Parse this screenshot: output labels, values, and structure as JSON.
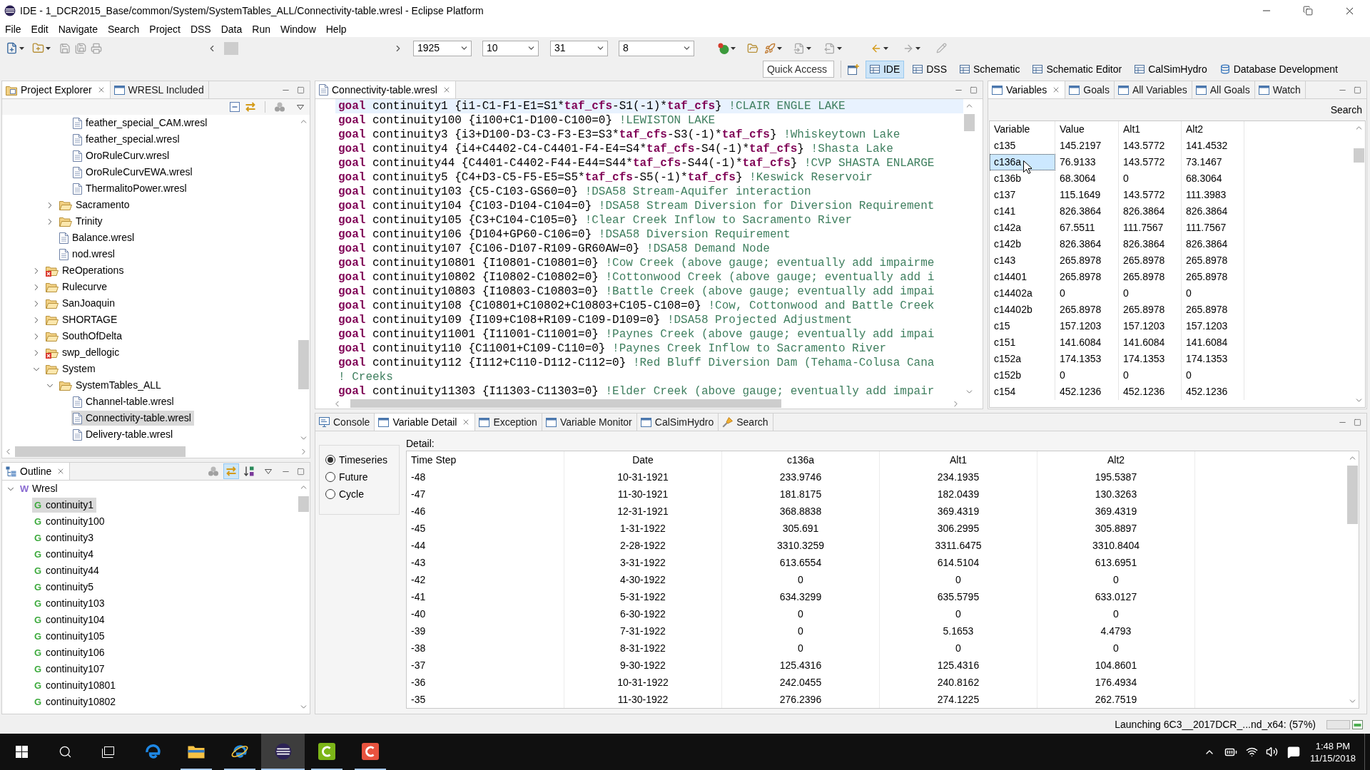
{
  "window": {
    "title": "IDE - 1_DCR2015_Base/common/System/SystemTables_ALL/Connectivity-table.wresl - Eclipse Platform"
  },
  "menu_bar": [
    "File",
    "Edit",
    "Navigate",
    "Search",
    "Project",
    "DSS",
    "Data",
    "Run",
    "Window",
    "Help"
  ],
  "toolbar": {
    "dropdowns": [
      "1925",
      "10",
      "31",
      "8"
    ]
  },
  "quick_access": {
    "placeholder": "Quick Access"
  },
  "perspectives": [
    {
      "label": "IDE",
      "selected": true,
      "kind": "view"
    },
    {
      "label": "DSS",
      "selected": false,
      "kind": "view"
    },
    {
      "label": "Schematic",
      "selected": false,
      "kind": "view"
    },
    {
      "label": "Schematic Editor",
      "selected": false,
      "kind": "view"
    },
    {
      "label": "CalSimHydro",
      "selected": false,
      "kind": "view"
    },
    {
      "label": "Database Development",
      "selected": false,
      "kind": "database"
    }
  ],
  "project_explorer": {
    "tabs": [
      {
        "label": "Project Explorer",
        "selected": true,
        "kind": "explorer"
      },
      {
        "label": "WRESL Included",
        "selected": false,
        "kind": "view"
      }
    ],
    "toolbar": [
      {
        "kind": "collapse",
        "on": false
      },
      {
        "kind": "link",
        "on": false
      },
      {
        "kind": "filter",
        "on": false
      }
    ],
    "tree": [
      {
        "children": [
          {
            "children": [
              {
                "label": "feather_special_CAM.wresl",
                "kind": "file",
                "selected": false,
                "error": false
              },
              {
                "label": "feather_special.wresl",
                "kind": "file",
                "selected": false,
                "error": false
              },
              {
                "label": "OroRuleCurv.wresl",
                "kind": "file",
                "selected": false,
                "error": false
              },
              {
                "label": "OroRuleCurvEWA.wresl",
                "kind": "file",
                "selected": false,
                "error": false
              },
              {
                "label": "ThermalitoPower.wresl",
                "kind": "file",
                "selected": false,
                "error": false
              }
            ]
          },
          {
            "label": "Sacramento",
            "kind": "folder",
            "expanded": false,
            "selected": false,
            "error": false
          },
          {
            "label": "Trinity",
            "kind": "folder",
            "expanded": false,
            "selected": false,
            "error": false
          },
          {
            "label": "Balance.wresl",
            "kind": "file",
            "selected": false,
            "error": false
          },
          {
            "label": "nod.wresl",
            "kind": "file",
            "selected": false,
            "error": false
          }
        ]
      },
      {
        "label": "ReOperations",
        "kind": "folder",
        "expanded": false,
        "selected": false,
        "error": true
      },
      {
        "label": "Rulecurve",
        "kind": "folder",
        "expanded": false,
        "selected": false,
        "error": false
      },
      {
        "label": "SanJoaquin",
        "kind": "folder",
        "expanded": false,
        "selected": false,
        "error": false
      },
      {
        "label": "SHORTAGE",
        "kind": "folder",
        "expanded": false,
        "selected": false,
        "error": false
      },
      {
        "label": "SouthOfDelta",
        "kind": "folder",
        "expanded": false,
        "selected": false,
        "error": false
      },
      {
        "label": "swp_dellogic",
        "kind": "folder",
        "expanded": false,
        "selected": false,
        "error": true
      },
      {
        "label": "System",
        "kind": "folder",
        "expanded": true,
        "selected": false,
        "error": false,
        "children": [
          {
            "label": "SystemTables_ALL",
            "kind": "folder",
            "expanded": true,
            "selected": false,
            "error": false,
            "children": [
              {
                "label": "Channel-table.wresl",
                "kind": "file",
                "selected": false,
                "error": false
              },
              {
                "label": "Connectivity-table.wresl",
                "kind": "file",
                "selected": true,
                "error": false
              },
              {
                "label": "Delivery-table.wresl",
                "kind": "file",
                "selected": false,
                "error": false
              }
            ]
          }
        ]
      }
    ]
  },
  "outline": {
    "tabs": [
      {
        "label": "Outline",
        "selected": true,
        "kind": "outline"
      }
    ],
    "toolbar": [
      {
        "kind": "filter",
        "on": false
      },
      {
        "kind": "link",
        "on": true
      },
      {
        "kind": "sort",
        "on": false
      }
    ],
    "tree": [
      {
        "label": "Wresl",
        "kind": "root",
        "letter": "W",
        "expanded": true,
        "selected": false,
        "children": [
          {
            "label": "continuity1",
            "kind": "goal",
            "letter": "G",
            "selected": true
          },
          {
            "label": "continuity100",
            "kind": "goal",
            "letter": "G",
            "selected": false
          },
          {
            "label": "continuity3",
            "kind": "goal",
            "letter": "G",
            "selected": false
          },
          {
            "label": "continuity4",
            "kind": "goal",
            "letter": "G",
            "selected": false
          },
          {
            "label": "continuity44",
            "kind": "goal",
            "letter": "G",
            "selected": false
          },
          {
            "label": "continuity5",
            "kind": "goal",
            "letter": "G",
            "selected": false
          },
          {
            "label": "continuity103",
            "kind": "goal",
            "letter": "G",
            "selected": false
          },
          {
            "label": "continuity104",
            "kind": "goal",
            "letter": "G",
            "selected": false
          },
          {
            "label": "continuity105",
            "kind": "goal",
            "letter": "G",
            "selected": false
          },
          {
            "label": "continuity106",
            "kind": "goal",
            "letter": "G",
            "selected": false
          },
          {
            "label": "continuity107",
            "kind": "goal",
            "letter": "G",
            "selected": false
          },
          {
            "label": "continuity10801",
            "kind": "goal",
            "letter": "G",
            "selected": false
          },
          {
            "label": "continuity10802",
            "kind": "goal",
            "letter": "G",
            "selected": false
          }
        ]
      }
    ]
  },
  "editor": {
    "tabs": [
      {
        "label": "Connectivity-table.wresl",
        "selected": true,
        "kind": "file"
      }
    ],
    "lines": [
      {
        "current": true,
        "segments": [
          {
            "kind": "keyword",
            "text": "goal"
          },
          {
            "kind": "code",
            "text": " continuity1 {i1-C1-F1-E1=S1*"
          },
          {
            "kind": "bold",
            "text": "taf_cfs"
          },
          {
            "kind": "code",
            "text": "-S1(-1)*"
          },
          {
            "kind": "bold",
            "text": "taf_cfs"
          },
          {
            "kind": "code",
            "text": "} "
          },
          {
            "kind": "comment",
            "text": "!CLAIR ENGLE LAKE"
          }
        ]
      },
      {
        "current": false,
        "segments": [
          {
            "kind": "keyword",
            "text": "goal"
          },
          {
            "kind": "code",
            "text": " continuity100 {i100+C1-D100-C100=0} "
          },
          {
            "kind": "comment",
            "text": "!LEWISTON LAKE"
          }
        ]
      },
      {
        "current": false,
        "segments": [
          {
            "kind": "keyword",
            "text": "goal"
          },
          {
            "kind": "code",
            "text": " continuity3 {i3+D100-D3-C3-F3-E3=S3*"
          },
          {
            "kind": "bold",
            "text": "taf_cfs"
          },
          {
            "kind": "code",
            "text": "-S3(-1)*"
          },
          {
            "kind": "bold",
            "text": "taf_cfs"
          },
          {
            "kind": "code",
            "text": "} "
          },
          {
            "kind": "comment",
            "text": "!Whiskeytown Lake"
          }
        ]
      },
      {
        "current": false,
        "segments": [
          {
            "kind": "keyword",
            "text": "goal"
          },
          {
            "kind": "code",
            "text": " continuity4 {i4+C4402-C4-C4401-F4-E4=S4*"
          },
          {
            "kind": "bold",
            "text": "taf_cfs"
          },
          {
            "kind": "code",
            "text": "-S4(-1)*"
          },
          {
            "kind": "bold",
            "text": "taf_cfs"
          },
          {
            "kind": "code",
            "text": "} "
          },
          {
            "kind": "comment",
            "text": "!Shasta Lake"
          }
        ]
      },
      {
        "current": false,
        "segments": [
          {
            "kind": "keyword",
            "text": "goal"
          },
          {
            "kind": "code",
            "text": " continuity44 {C4401-C4402-F44-E44=S44*"
          },
          {
            "kind": "bold",
            "text": "taf_cfs"
          },
          {
            "kind": "code",
            "text": "-S44(-1)*"
          },
          {
            "kind": "bold",
            "text": "taf_cfs"
          },
          {
            "kind": "code",
            "text": "} "
          },
          {
            "kind": "comment",
            "text": "!CVP SHASTA ENLARGE"
          }
        ]
      },
      {
        "current": false,
        "segments": [
          {
            "kind": "keyword",
            "text": "goal"
          },
          {
            "kind": "code",
            "text": " continuity5 {C4+D3-C5-F5-E5=S5*"
          },
          {
            "kind": "bold",
            "text": "taf_cfs"
          },
          {
            "kind": "code",
            "text": "-S5(-1)*"
          },
          {
            "kind": "bold",
            "text": "taf_cfs"
          },
          {
            "kind": "code",
            "text": "} "
          },
          {
            "kind": "comment",
            "text": "!Keswick Reservoir"
          }
        ]
      },
      {
        "current": false,
        "segments": [
          {
            "kind": "keyword",
            "text": "goal"
          },
          {
            "kind": "code",
            "text": " continuity103 {C5-C103-GS60=0} "
          },
          {
            "kind": "comment",
            "text": "!DSA58 Stream-Aquifer interaction"
          }
        ]
      },
      {
        "current": false,
        "segments": [
          {
            "kind": "keyword",
            "text": "goal"
          },
          {
            "kind": "code",
            "text": " continuity104 {C103-D104-C104=0} "
          },
          {
            "kind": "comment",
            "text": "!DSA58 Stream Diversion for Diversion Requirement"
          }
        ]
      },
      {
        "current": false,
        "segments": [
          {
            "kind": "keyword",
            "text": "goal"
          },
          {
            "kind": "code",
            "text": " continuity105 {C3+C104-C105=0} "
          },
          {
            "kind": "comment",
            "text": "!Clear Creek Inflow to Sacramento River"
          }
        ]
      },
      {
        "current": false,
        "segments": [
          {
            "kind": "keyword",
            "text": "goal"
          },
          {
            "kind": "code",
            "text": " continuity106 {D104+GP60-C106=0} "
          },
          {
            "kind": "comment",
            "text": "!DSA58 Diversion Requirement"
          }
        ]
      },
      {
        "current": false,
        "segments": [
          {
            "kind": "keyword",
            "text": "goal"
          },
          {
            "kind": "code",
            "text": " continuity107 {C106-D107-R109-GR60AW=0} "
          },
          {
            "kind": "comment",
            "text": "!DSA58 Demand Node"
          }
        ]
      },
      {
        "current": false,
        "segments": [
          {
            "kind": "keyword",
            "text": "goal"
          },
          {
            "kind": "code",
            "text": " continuity10801 {I10801-C10801=0} "
          },
          {
            "kind": "comment",
            "text": "!Cow Creek (above gauge; eventually add impairme"
          }
        ]
      },
      {
        "current": false,
        "segments": [
          {
            "kind": "keyword",
            "text": "goal"
          },
          {
            "kind": "code",
            "text": " continuity10802 {I10802-C10802=0} "
          },
          {
            "kind": "comment",
            "text": "!Cottonwood Creek (above gauge; eventually add i"
          }
        ]
      },
      {
        "current": false,
        "segments": [
          {
            "kind": "keyword",
            "text": "goal"
          },
          {
            "kind": "code",
            "text": " continuity10803 {I10803-C10803=0} "
          },
          {
            "kind": "comment",
            "text": "!Battle Creek (above gauge; eventually add impai"
          }
        ]
      },
      {
        "current": false,
        "segments": [
          {
            "kind": "keyword",
            "text": "goal"
          },
          {
            "kind": "code",
            "text": " continuity108 {C10801+C10802+C10803+C105-C108=0} "
          },
          {
            "kind": "comment",
            "text": "!Cow, Cottonwood and Battle Creek"
          }
        ]
      },
      {
        "current": false,
        "segments": [
          {
            "kind": "keyword",
            "text": "goal"
          },
          {
            "kind": "code",
            "text": " continuity109 {I109+C108+R109-C109-D109=0} "
          },
          {
            "kind": "comment",
            "text": "!DSA58 Projected Adjustment"
          }
        ]
      },
      {
        "current": false,
        "segments": [
          {
            "kind": "keyword",
            "text": "goal"
          },
          {
            "kind": "code",
            "text": " continuity11001 {I11001-C11001=0} "
          },
          {
            "kind": "comment",
            "text": "!Paynes Creek (above gauge; eventually add impai"
          }
        ]
      },
      {
        "current": false,
        "segments": [
          {
            "kind": "keyword",
            "text": "goal"
          },
          {
            "kind": "code",
            "text": " continuity110 {C11001+C109-C110=0} "
          },
          {
            "kind": "comment",
            "text": "!Paynes Creek Inflow to Sacramento River"
          }
        ]
      },
      {
        "current": false,
        "segments": [
          {
            "kind": "keyword",
            "text": "goal"
          },
          {
            "kind": "code",
            "text": " continuity112 {I112+C110-D112-C112=0} "
          },
          {
            "kind": "comment",
            "text": "!Red Bluff Diversion Dam (Tehama-Colusa Cana"
          }
        ]
      },
      {
        "current": false,
        "segments": [
          {
            "kind": "comment",
            "text": "! Creeks"
          }
        ]
      },
      {
        "current": false,
        "segments": [
          {
            "kind": "keyword",
            "text": "goal"
          },
          {
            "kind": "code",
            "text": " continuity11303 {I11303-C11303=0} "
          },
          {
            "kind": "comment",
            "text": "!Elder Creek (above gauge; eventually add impair"
          }
        ]
      }
    ]
  },
  "variables": {
    "tabs": [
      {
        "label": "Variables",
        "selected": true,
        "kind": "view"
      },
      {
        "label": "Goals",
        "selected": false,
        "kind": "view"
      },
      {
        "label": "All Variables",
        "selected": false,
        "kind": "view"
      },
      {
        "label": "All Goals",
        "selected": false,
        "kind": "view"
      },
      {
        "label": "Watch",
        "selected": false,
        "kind": "view"
      }
    ],
    "search_label": "Search",
    "columns": [
      "Variable",
      "Value",
      "Alt1",
      "Alt2"
    ],
    "rows": [
      {
        "selected": false,
        "cells": [
          "c135",
          "145.2197",
          "143.5772",
          "141.4532"
        ]
      },
      {
        "selected": true,
        "cells": [
          "c136a",
          "76.9133",
          "143.5772",
          "73.1467"
        ]
      },
      {
        "selected": false,
        "cells": [
          "c136b",
          "68.3064",
          "0",
          "68.3064"
        ]
      },
      {
        "selected": false,
        "cells": [
          "c137",
          "115.1649",
          "143.5772",
          "111.3983"
        ]
      },
      {
        "selected": false,
        "cells": [
          "c141",
          "826.3864",
          "826.3864",
          "826.3864"
        ]
      },
      {
        "selected": false,
        "cells": [
          "c142a",
          "67.5511",
          "111.7567",
          "111.7567"
        ]
      },
      {
        "selected": false,
        "cells": [
          "c142b",
          "826.3864",
          "826.3864",
          "826.3864"
        ]
      },
      {
        "selected": false,
        "cells": [
          "c143",
          "265.8978",
          "265.8978",
          "265.8978"
        ]
      },
      {
        "selected": false,
        "cells": [
          "c14401",
          "265.8978",
          "265.8978",
          "265.8978"
        ]
      },
      {
        "selected": false,
        "cells": [
          "c14402a",
          "0",
          "0",
          "0"
        ]
      },
      {
        "selected": false,
        "cells": [
          "c14402b",
          "265.8978",
          "265.8978",
          "265.8978"
        ]
      },
      {
        "selected": false,
        "cells": [
          "c15",
          "157.1203",
          "157.1203",
          "157.1203"
        ]
      },
      {
        "selected": false,
        "cells": [
          "c151",
          "141.6084",
          "141.6084",
          "141.6084"
        ]
      },
      {
        "selected": false,
        "cells": [
          "c152a",
          "174.1353",
          "174.1353",
          "174.1353"
        ]
      },
      {
        "selected": false,
        "cells": [
          "c152b",
          "0",
          "0",
          "0"
        ]
      },
      {
        "selected": false,
        "cells": [
          "c154",
          "452.1236",
          "452.1236",
          "452.1236"
        ]
      }
    ]
  },
  "bottom_panel": {
    "tabs": [
      {
        "label": "Console",
        "selected": false,
        "kind": "console"
      },
      {
        "label": "Variable Detail",
        "selected": true,
        "kind": "view"
      },
      {
        "label": "Exception",
        "selected": false,
        "kind": "view"
      },
      {
        "label": "Variable Monitor",
        "selected": false,
        "kind": "view"
      },
      {
        "label": "CalSimHydro",
        "selected": false,
        "kind": "view"
      },
      {
        "label": "Search",
        "selected": false,
        "kind": "search"
      }
    ],
    "modes": [
      {
        "label": "Timeseries",
        "selected": true
      },
      {
        "label": "Future",
        "selected": false
      },
      {
        "label": "Cycle",
        "selected": false
      }
    ],
    "detail_label": "Detail:",
    "columns": [
      "Time Step",
      "Date",
      "c136a",
      "Alt1",
      "Alt2"
    ],
    "rows": [
      [
        "-48",
        "10-31-1921",
        "233.9746",
        "234.1935",
        "195.5387"
      ],
      [
        "-47",
        "11-30-1921",
        "181.8175",
        "182.0439",
        "130.3263"
      ],
      [
        "-46",
        "12-31-1921",
        "368.8838",
        "369.4319",
        "369.4319"
      ],
      [
        "-45",
        "1-31-1922",
        "305.691",
        "306.2995",
        "305.8897"
      ],
      [
        "-44",
        "2-28-1922",
        "3310.3259",
        "3311.6475",
        "3310.8404"
      ],
      [
        "-43",
        "3-31-1922",
        "613.6554",
        "614.5104",
        "613.6951"
      ],
      [
        "-42",
        "4-30-1922",
        "0",
        "0",
        "0"
      ],
      [
        "-41",
        "5-31-1922",
        "634.3299",
        "635.5795",
        "633.0127"
      ],
      [
        "-40",
        "6-30-1922",
        "0",
        "0",
        "0"
      ],
      [
        "-39",
        "7-31-1922",
        "0",
        "5.1653",
        "4.4793"
      ],
      [
        "-38",
        "8-31-1922",
        "0",
        "0",
        "0"
      ],
      [
        "-37",
        "9-30-1922",
        "125.4316",
        "125.4316",
        "104.8601"
      ],
      [
        "-36",
        "10-31-1922",
        "242.0455",
        "240.8162",
        "176.4934"
      ],
      [
        "-35",
        "11-30-1922",
        "276.2396",
        "274.1225",
        "262.7519"
      ]
    ]
  },
  "status_bar": {
    "message": "Launching 6C3__2017DCR_...nd_x64: (57%)"
  },
  "taskbar": {
    "apps": [
      {
        "kind": "swirl",
        "running": false,
        "active": false
      },
      {
        "kind": "folder",
        "running": true,
        "active": false
      },
      {
        "kind": "orbit",
        "running": true,
        "active": false
      },
      {
        "kind": "stripes",
        "running": true,
        "active": true
      },
      {
        "kind": "lime",
        "running": true,
        "active": false
      },
      {
        "kind": "coral",
        "running": true,
        "active": false
      }
    ],
    "time": "1:48 PM",
    "date": "11/15/2018"
  }
}
